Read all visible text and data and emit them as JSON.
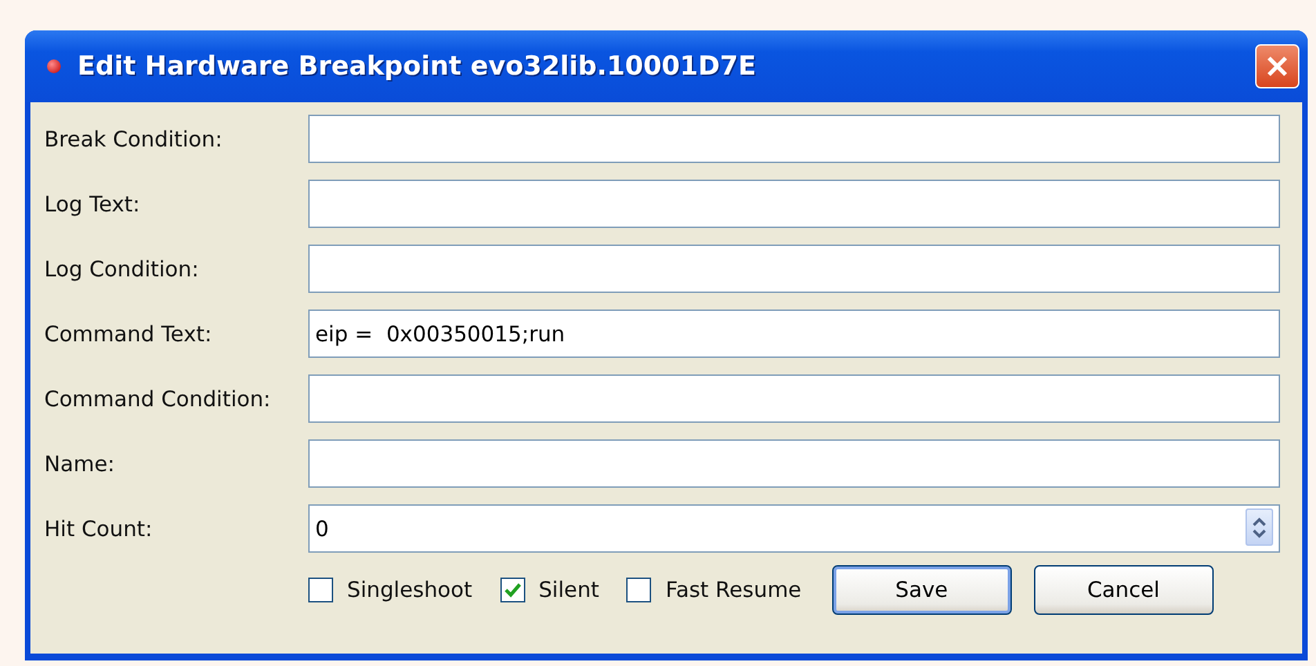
{
  "window": {
    "title": "Edit Hardware Breakpoint evo32lib.10001D7E"
  },
  "fields": [
    {
      "label": "Break Condition:"
    },
    {
      "label": "Log Text:"
    },
    {
      "label": "Log Condition:"
    },
    {
      "label": "Command Text:",
      "value": "eip =  0x00350015;run"
    },
    {
      "label": "Command Condition:"
    },
    {
      "label": "Name:"
    },
    {
      "label": "Hit Count:",
      "value": "0",
      "kind": "spin"
    }
  ],
  "checkboxes": [
    {
      "label": "Singleshoot",
      "checked": false
    },
    {
      "label": "Silent",
      "checked": true
    },
    {
      "label": "Fast Resume",
      "checked": false
    }
  ],
  "buttons": [
    {
      "label": "Save",
      "selected": true
    },
    {
      "label": "Cancel",
      "selected": false
    }
  ]
}
